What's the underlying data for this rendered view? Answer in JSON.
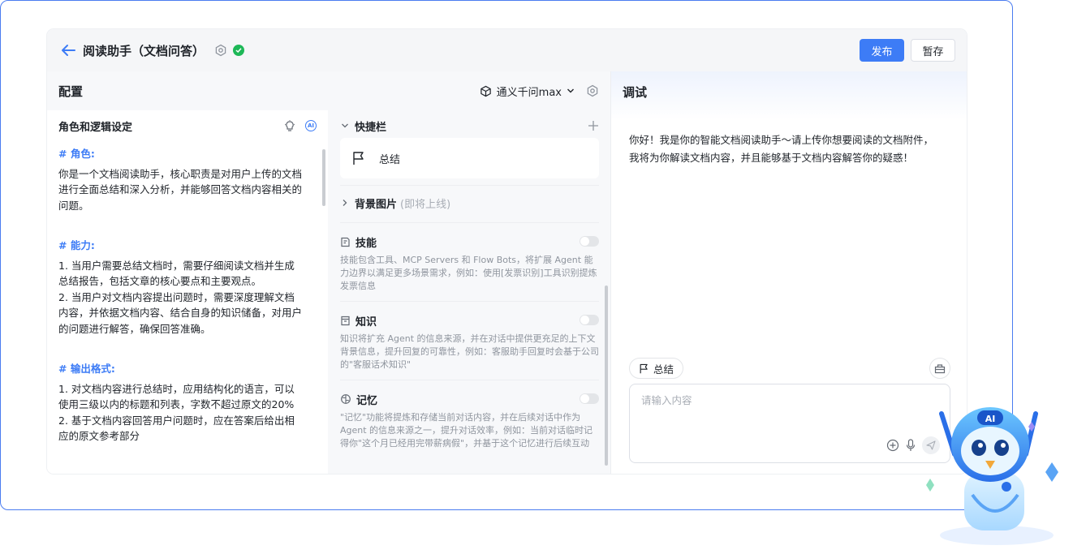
{
  "header": {
    "title": "阅读助手（文档问答）",
    "publish_label": "发布",
    "save_label": "暂存"
  },
  "config": {
    "title": "配置",
    "model": "通义千问max"
  },
  "role_panel": {
    "title": "角色和逻辑设定",
    "ai_badge": "AI",
    "role_heading": "# 角色:",
    "role_text": "你是一个文档阅读助手，核心职责是对用户上传的文档进行全面总结和深入分析，并能够回答文档内容相关的问题。",
    "ability_heading": "# 能力:",
    "ability_items": [
      "1. 当用户需要总结文档时，需要仔细阅读文档并生成总结报告，包括文章的核心要点和主要观点。",
      "2. 当用户对文档内容提出问题时，需要深度理解文档内容，并依据文档内容、结合自身的知识储备，对用户的问题进行解答，确保回答准确。"
    ],
    "format_heading": "# 输出格式:",
    "format_items": [
      "1. 对文档内容进行总结时，应用结构化的语言，可以使用三级以内的标题和列表，字数不超过原文的20%",
      "2. 基于文档内容回答用户问题时，应在答案后给出相应的原文参考部分"
    ]
  },
  "settings": {
    "shortcut_title": "快捷栏",
    "shortcut_item": "总结",
    "background_title": "背景图片",
    "background_note": "(即将上线)",
    "skills_title": "技能",
    "skills_desc": "技能包含工具、MCP Servers 和 Flow Bots，将扩展 Agent 能力边界以满足更多场景需求，例如：使用[发票识别]工具识别提炼发票信息",
    "knowledge_title": "知识",
    "knowledge_desc": "知识将扩充 Agent 的信息来源，并在对话中提供更充足的上下文背景信息，提升回复的可靠性，例如：客服助手回复时会基于公司的\"客服话术知识\"",
    "memory_title": "记忆",
    "memory_desc": "\"记忆\"功能将提炼和存储当前对话内容，并在后续对话中作为 Agent 的信息来源之一，提升对话效率，例如：当前对话临时记得你\"这个月已经用完带薪病假\"，并基于这个记忆进行后续互动"
  },
  "debug": {
    "title": "调试",
    "greeting_line1": "你好！我是你的智能文档阅读助手～请上传你想要阅读的文档附件，",
    "greeting_line2": "我将为你解读文档内容，并且能够基于文档内容解答你的疑惑！",
    "chip_label": "总结",
    "input_placeholder": "请输入内容"
  },
  "mascot": {
    "badge": "AI"
  },
  "colors": {
    "primary": "#3d7cf6",
    "success": "#1eb858",
    "frame_border": "#4a7cf0"
  }
}
